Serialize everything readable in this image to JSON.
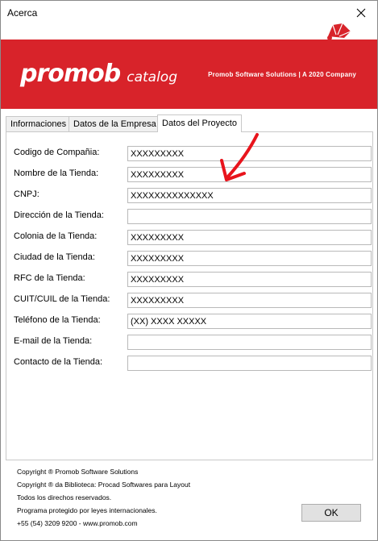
{
  "window": {
    "title": "Acerca"
  },
  "banner": {
    "logo_primary": "promob",
    "logo_secondary": "catalog",
    "company": "Promob Software Solutions | A 2020 Company",
    "brand_color": "#d8232a"
  },
  "tabs": [
    {
      "label": "Informaciones",
      "active": false
    },
    {
      "label": "Datos de la Empresa",
      "active": false
    },
    {
      "label": "Datos del Proyecto",
      "active": true
    }
  ],
  "fields": [
    {
      "label": "Codigo de Compañia:",
      "value": "XXXXXXXXX"
    },
    {
      "label": "Nombre de la Tienda:",
      "value": "XXXXXXXXX"
    },
    {
      "label": "CNPJ:",
      "value": "XXXXXXXXXXXXXX"
    },
    {
      "label": "Dirección de la Tienda:",
      "value": ""
    },
    {
      "label": "Colonia de la Tienda:",
      "value": "XXXXXXXXX"
    },
    {
      "label": "Ciudad de la Tienda:",
      "value": "XXXXXXXXX"
    },
    {
      "label": "RFC de la Tienda:",
      "value": "XXXXXXXXX"
    },
    {
      "label": "CUIT/CUIL de la Tienda:",
      "value": "XXXXXXXXX"
    },
    {
      "label": "Teléfono de la Tienda:",
      "value": "(XX) XXXX XXXXX"
    },
    {
      "label": "E-mail de la Tienda:",
      "value": ""
    },
    {
      "label": "Contacto de la Tienda:",
      "value": ""
    }
  ],
  "footer": {
    "lines": [
      "Copyright ® Promob Software Solutions",
      "Copyright ® da Biblioteca: Procad Softwares para Layout",
      "Todos los direchos reservados.",
      "Programa protegido por leyes internacionales.",
      "+55 (54) 3209 9200  -  www.promob.com"
    ]
  },
  "buttons": {
    "ok_label": "OK"
  }
}
